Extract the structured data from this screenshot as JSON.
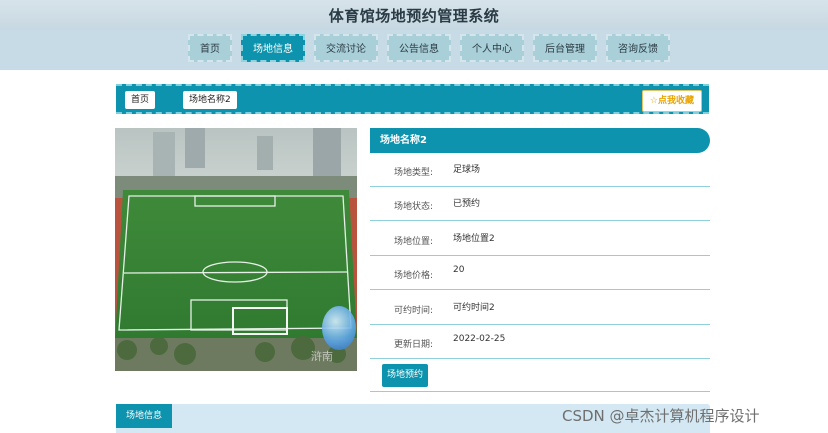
{
  "header": {
    "title": "体育馆场地预约管理系统"
  },
  "nav": {
    "items": [
      {
        "label": "首页"
      },
      {
        "label": "场地信息",
        "active": true
      },
      {
        "label": "交流讨论"
      },
      {
        "label": "公告信息"
      },
      {
        "label": "个人中心"
      },
      {
        "label": "后台管理"
      },
      {
        "label": "咨询反馈"
      }
    ]
  },
  "breadcrumb": {
    "home": "首页",
    "current": "场地名称2",
    "collect_label": "☆点我收藏"
  },
  "photo": {
    "overlay_text": "浒南"
  },
  "detail": {
    "title": "场地名称2",
    "rows": [
      {
        "label": "场地类型:",
        "value": "足球场"
      },
      {
        "label": "场地状态:",
        "value": "已预约"
      },
      {
        "label": "场地位置:",
        "value": "场地位置2"
      },
      {
        "label": "场地价格:",
        "value": "20"
      },
      {
        "label": "可约时间:",
        "value": "可约时间2"
      },
      {
        "label": "更新日期:",
        "value": "2022-02-25"
      }
    ],
    "book_label": "场地预约"
  },
  "section": {
    "tab_label": "场地信息"
  },
  "watermark": "CSDN @卓杰计算机程序设计",
  "colors": {
    "accent": "#0d93ad",
    "nav_bg": "#c6dbe6",
    "star": "#e8a400"
  }
}
